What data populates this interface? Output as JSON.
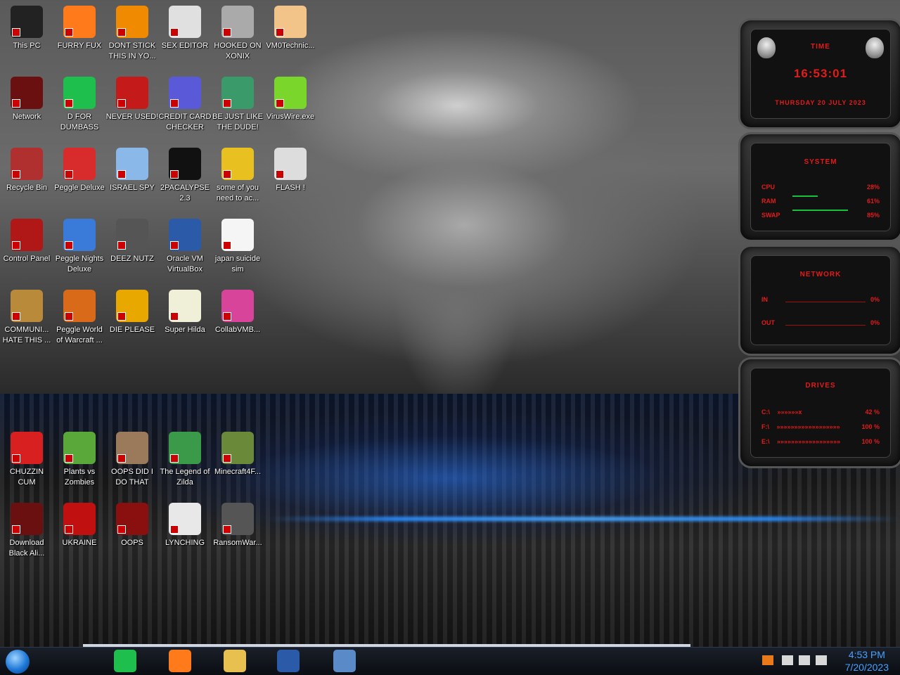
{
  "desktop": {
    "icons": [
      {
        "label": "This PC",
        "icon": "computer-icon",
        "color": "#222"
      },
      {
        "label": "FURRY FUX",
        "icon": "firefox-icon",
        "color": "#ff7a1a"
      },
      {
        "label": "DONT STICK THIS IN YO...",
        "icon": "vlc-icon",
        "color": "#f08a00"
      },
      {
        "label": "SEX EDITOR",
        "icon": "hxd-icon",
        "color": "#e0e0e0"
      },
      {
        "label": "HOOKED ON XONIX",
        "icon": "xonix-icon",
        "color": "#aaa"
      },
      {
        "label": "VM0Technic...",
        "icon": "doctor-icon",
        "color": "#f2c48a"
      },
      {
        "label": "Network",
        "icon": "network-icon",
        "color": "#6a1010"
      },
      {
        "label": "D FOR DUMBASS",
        "icon": "spotify-icon",
        "color": "#1fbf4e"
      },
      {
        "label": "NEVER USED!",
        "icon": "devcpp-icon",
        "color": "#c41a1a"
      },
      {
        "label": "CREDIT CARD CHECKER",
        "icon": "credit-card-icon",
        "color": "#5a5ad8"
      },
      {
        "label": "BE JUST LIKE THE DUDE!",
        "icon": "bonzi-icon",
        "color": "#3a9a6a"
      },
      {
        "label": "VirusWire.exe",
        "icon": "limewire-icon",
        "color": "#7ad62a"
      },
      {
        "label": "Recycle Bin",
        "icon": "recycle-bin-icon",
        "color": "#b03030"
      },
      {
        "label": "Peggle Deluxe",
        "icon": "peggle-icon",
        "color": "#d82c2c"
      },
      {
        "label": "ISRAEL SPY",
        "icon": "remote-desktop-icon",
        "color": "#8ab8e8"
      },
      {
        "label": "2PACALYPSE 2.3",
        "icon": "terminal-icon",
        "color": "#111"
      },
      {
        "label": "some of you need to ac...",
        "icon": "beaver-icon",
        "color": "#e8c020"
      },
      {
        "label": "FLASH !",
        "icon": "flash-icon",
        "color": "#ddd"
      },
      {
        "label": "Control Panel",
        "icon": "control-panel-icon",
        "color": "#b01818"
      },
      {
        "label": "Peggle Nights Deluxe",
        "icon": "peggle-nights-icon",
        "color": "#3a7ad8"
      },
      {
        "label": "DEEZ NUTZ",
        "icon": "windows-stack-icon",
        "color": "#555"
      },
      {
        "label": "Oracle VM VirtualBox",
        "icon": "virtualbox-icon",
        "color": "#2a5aa8"
      },
      {
        "label": "japan suicide sim",
        "icon": "japan-sim-icon",
        "color": "#f5f5f5"
      },
      {
        "label": "COMMUNI... HATE THIS ...",
        "icon": "money-bag-icon",
        "color": "#b88a3a"
      },
      {
        "label": "Peggle World of Warcraft ...",
        "icon": "peggle-wow-icon",
        "color": "#d86a1a"
      },
      {
        "label": "DIE PLEASE",
        "icon": "acrobat-de-icon",
        "color": "#e8a800"
      },
      {
        "label": "Super Hilda",
        "icon": "hilda-icon",
        "color": "#f0f0d8"
      },
      {
        "label": "CollabVMB...",
        "icon": "collabvm-icon",
        "color": "#d8449a"
      },
      {
        "label": "CHUZZIN CUM",
        "icon": "chuzzle-icon",
        "color": "#d82020"
      },
      {
        "label": "Plants vs Zombies",
        "icon": "pvz-icon",
        "color": "#5aa83a"
      },
      {
        "label": "OOPS DID I DO THAT",
        "icon": "portrait-icon",
        "color": "#9a7a5a"
      },
      {
        "label": "The Legend of Zilda",
        "icon": "zelda-icon",
        "color": "#3a9a4a"
      },
      {
        "label": "Minecraft4F...",
        "icon": "minecraft-icon",
        "color": "#6a8a3a"
      },
      {
        "label": "Download Black Ali...",
        "icon": "alienware-icon",
        "color": "#6a1010"
      },
      {
        "label": "UKRAINE",
        "icon": "radiation-icon",
        "color": "#c01010"
      },
      {
        "label": "OOPS",
        "icon": "red-screen-icon",
        "color": "#8a1010"
      },
      {
        "label": "LYNCHING",
        "icon": "rope-icon",
        "color": "#e8e8e8"
      },
      {
        "label": "RansomWar...",
        "icon": "skull-icon",
        "color": "#555"
      }
    ]
  },
  "gadgets": {
    "time": {
      "title": "TIME",
      "clock": "16:53:01",
      "date": "THURSDAY 20 JULY 2023"
    },
    "system": {
      "title": "SYSTEM",
      "rows": [
        {
          "label": "CPU",
          "value": "28%",
          "fill": 0.28
        },
        {
          "label": "RAM",
          "value": "61%",
          "fill": 0.61
        },
        {
          "label": "SWAP",
          "value": "85%",
          "fill": 0.85
        }
      ]
    },
    "network": {
      "title": "NETWORK",
      "rows": [
        {
          "label": "IN",
          "value": "0%"
        },
        {
          "label": "OUT",
          "value": "0%"
        }
      ]
    },
    "drives": {
      "title": "DRIVES",
      "rows": [
        {
          "label": "C:\\",
          "bars": "»»»»»»x",
          "value": "42 %"
        },
        {
          "label": "F:\\",
          "bars": "»»»»»»»»»»»»»»»»»»",
          "value": "100 %"
        },
        {
          "label": "E:\\",
          "bars": "»»»»»»»»»»»»»»»»»»",
          "value": "100 %"
        }
      ]
    }
  },
  "taskbar": {
    "apps": [
      "spotify-icon",
      "firefox-icon",
      "file-explorer-icon",
      "virtualbox-icon",
      "windows10-icon"
    ],
    "tray_icons": [
      "java-icon",
      "action-center-icon",
      "network-tray-icon",
      "volume-icon"
    ],
    "clock": {
      "time": "4:53 PM",
      "date": "7/20/2023"
    }
  }
}
